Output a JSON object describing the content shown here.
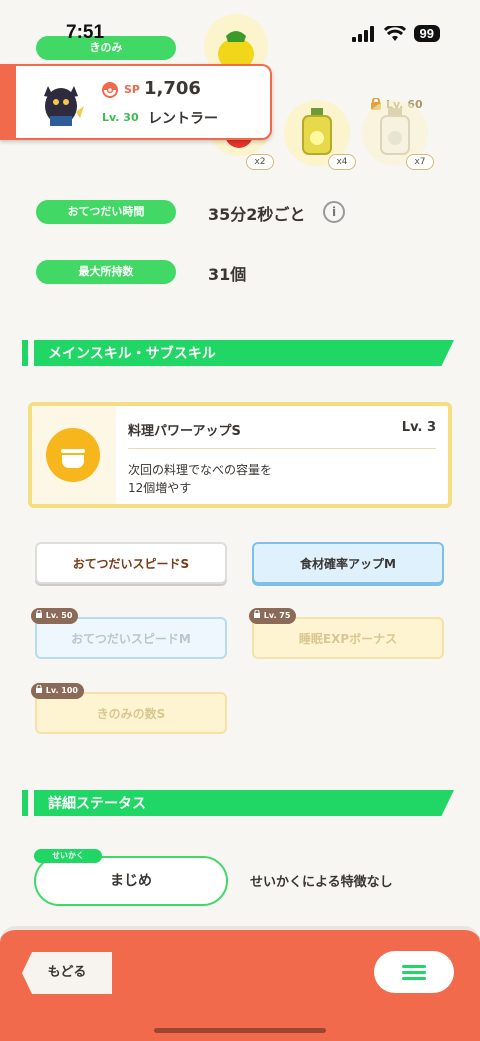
{
  "status": {
    "time": "7:51",
    "battery": "99"
  },
  "top": {
    "berry_label": "きのみ",
    "pokemon": {
      "sp_label": "SP",
      "sp_value": "1,706",
      "level": "Lv. 30",
      "name": "レントラー"
    },
    "ingredients": [
      {
        "qty": "x2",
        "icon": "tomato-icon"
      },
      {
        "qty": "x4",
        "icon": "oil-bottle-icon"
      },
      {
        "qty": "x7",
        "icon": "milk-bottle-icon",
        "unlock": "Lv. 60"
      }
    ]
  },
  "stats": [
    {
      "label": "おてつだい時間",
      "value": "35分2秒ごと"
    },
    {
      "label": "最大所持数",
      "value": "31個"
    }
  ],
  "skills_section": {
    "title": "メインスキル・サブスキル",
    "main_skill": {
      "name": "料理パワーアップS",
      "level": "Lv. 3",
      "desc_line1": "次回の料理でなべの容量を",
      "desc_line2": "12個増やす"
    },
    "sub_skills": [
      {
        "name": "おてつだいスピードS",
        "unlock": ""
      },
      {
        "name": "食材確率アップM",
        "unlock": ""
      },
      {
        "name": "おてつだいスピードM",
        "unlock": "Lv. 50"
      },
      {
        "name": "睡眠EXPボーナス",
        "unlock": "Lv. 75"
      },
      {
        "name": "きのみの数S",
        "unlock": "Lv. 100"
      }
    ]
  },
  "detail_section": {
    "title": "詳細ステータス",
    "nature_label": "せいかく",
    "nature_value": "まじめ",
    "nature_desc": "せいかくによる特徴なし"
  },
  "footer": {
    "back_label": "もどる"
  }
}
